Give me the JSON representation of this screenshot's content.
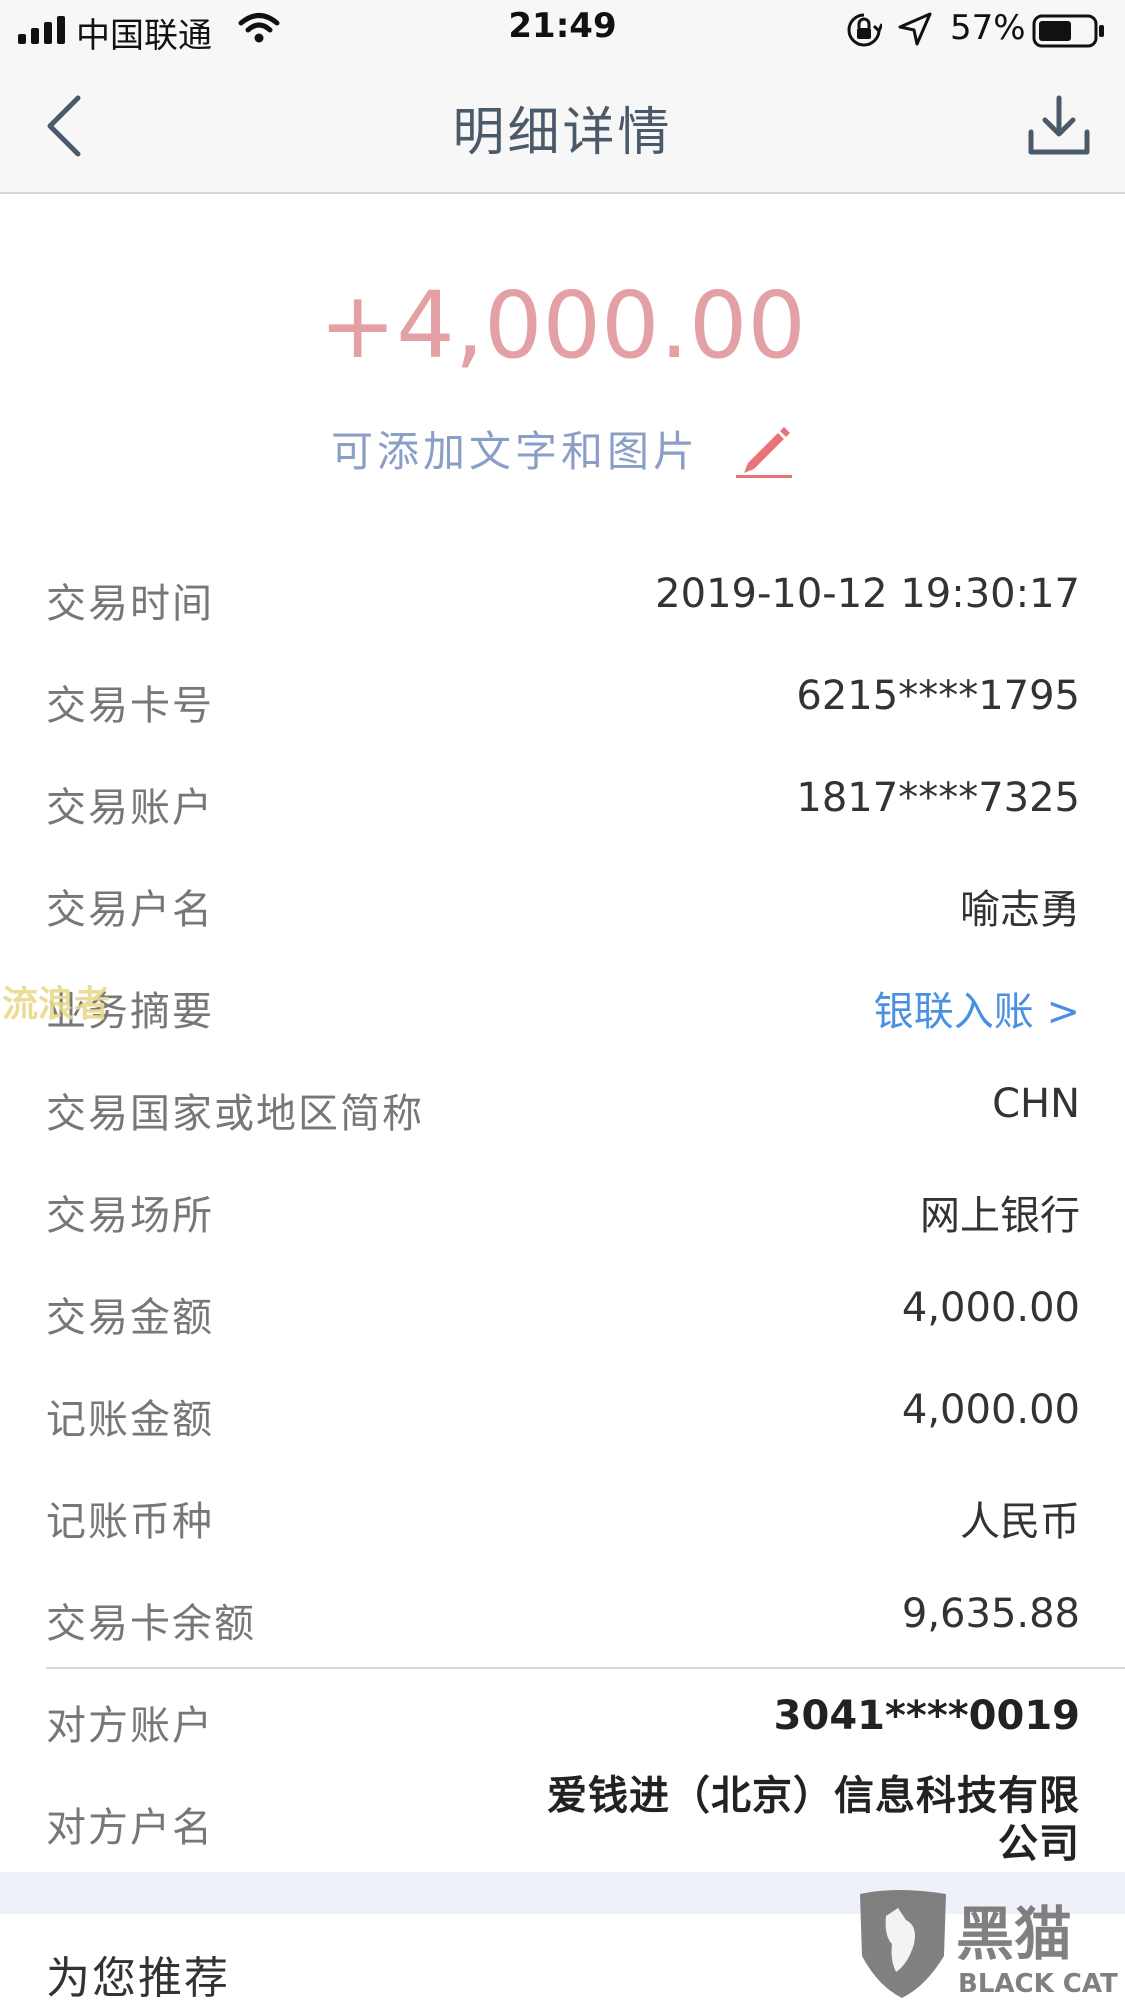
{
  "status_bar": {
    "carrier": "中国联通",
    "time": "21:49",
    "battery": "57%"
  },
  "nav": {
    "title": "明细详情"
  },
  "amount": "+4,000.00",
  "note": {
    "text": "可添加文字和图片"
  },
  "details": [
    {
      "label": "交易时间",
      "value": "2019-10-12 19:30:17"
    },
    {
      "label": "交易卡号",
      "value": "6215****1795"
    },
    {
      "label": "交易账户",
      "value": "1817****7325"
    },
    {
      "label": "交易户名",
      "value": "喻志勇"
    },
    {
      "label": "业务摘要",
      "value": "银联入账 >"
    },
    {
      "label": "交易国家或地区简称",
      "value": "CHN"
    },
    {
      "label": "交易场所",
      "value": "网上银行"
    },
    {
      "label": "交易金额",
      "value": "4,000.00"
    },
    {
      "label": "记账金额",
      "value": "4,000.00"
    },
    {
      "label": "记账币种",
      "value": "人民币"
    },
    {
      "label": "交易卡余额",
      "value": "9,635.88"
    }
  ],
  "counterparty": {
    "account_label": "对方账户",
    "account_value": "3041****0019",
    "name_label": "对方户名",
    "name_value": "爱钱进（北京）信息科技有限公司"
  },
  "recommend_title": "为您推荐",
  "watermarks": {
    "left": "流浪者",
    "logo_cn": "黑猫",
    "logo_en": "BLACK CAT"
  },
  "colors": {
    "amount": "#e3a1a6",
    "link": "#4a90e2",
    "note": "#8a9fc6",
    "edit_icon": "#e8747a"
  }
}
